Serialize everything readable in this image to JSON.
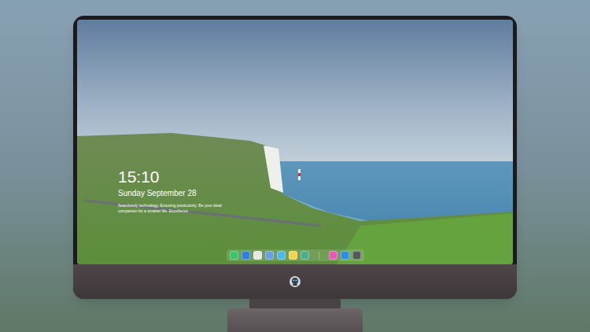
{
  "screen": {
    "clock": {
      "time": "15:10",
      "date": "Sunday September 28"
    },
    "tagline": "Seamlessly technology, Ensuring productivity. Be your ideal companion for a smarter life. Excellence"
  },
  "dock": {
    "apps": [
      {
        "color": "#3bc46a"
      },
      {
        "color": "#2f7fe0"
      },
      {
        "color": "#e6e6e6"
      },
      {
        "color": "#6aa0e0"
      },
      {
        "color": "#4fb8e8"
      },
      {
        "color": "#f5d34a"
      },
      {
        "color": "#4caf8a"
      }
    ],
    "recent": [
      {
        "color": "#e85ab8"
      },
      {
        "color": "#2e8be6"
      },
      {
        "color": "#55575c"
      }
    ]
  }
}
